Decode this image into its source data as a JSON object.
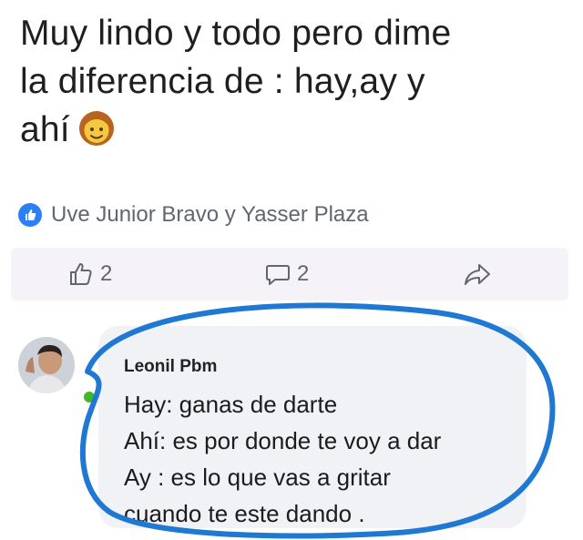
{
  "post": {
    "text_lines": [
      "Muy lindo y todo pero dime",
      "la diferencia de : hay,ay y",
      "ahí"
    ],
    "emoji": "woman-face-emoji"
  },
  "reactions": {
    "names": "Uve Junior Bravo y Yasser Plaza",
    "icon": "like-badge-icon"
  },
  "actions": {
    "like_count": "2",
    "comment_count": "2",
    "share_icon": "share-icon"
  },
  "comment": {
    "author": "Leonil Pbm",
    "lines": [
      "Hay: ganas de darte",
      "Ahí: es por donde te voy a dar",
      "Ay : es lo que vas a gritar",
      "cuando te este dando ."
    ]
  },
  "colors": {
    "annotation_circle": "#1f78d1",
    "like_blue": "#2d7ff9",
    "muted_text": "#606770"
  }
}
